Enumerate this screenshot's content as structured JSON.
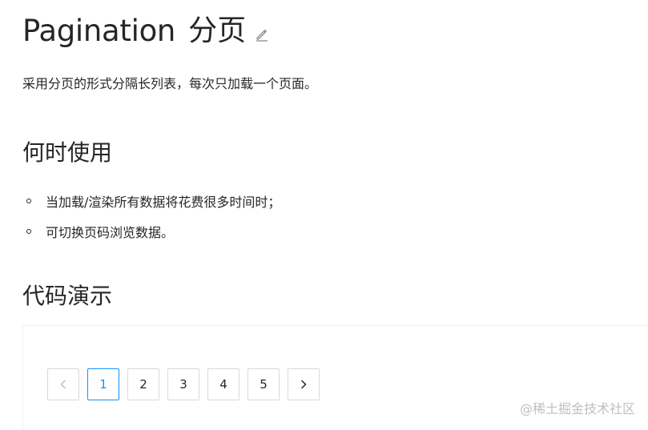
{
  "header": {
    "title": "Pagination",
    "title_cn": "分页"
  },
  "intro": {
    "text": "采用分页的形式分隔长列表，每次只加载一个页面。"
  },
  "when_to_use": {
    "heading": "何时使用",
    "items": [
      "当加载/渲染所有数据将花费很多时间时；",
      "可切换页码浏览数据。"
    ]
  },
  "demo": {
    "heading": "代码演示"
  },
  "pagination": {
    "pages": [
      "1",
      "2",
      "3",
      "4",
      "5"
    ],
    "current": "1",
    "prev_icon": "chevron-left-icon",
    "next_icon": "chevron-right-icon",
    "prev_disabled": true
  },
  "watermark": {
    "text": "@稀土掘金技术社区"
  },
  "colors": {
    "accent": "#1890ff",
    "text": "#262626",
    "border": "#d9d9d9",
    "disabled": "#bfbfbf"
  }
}
